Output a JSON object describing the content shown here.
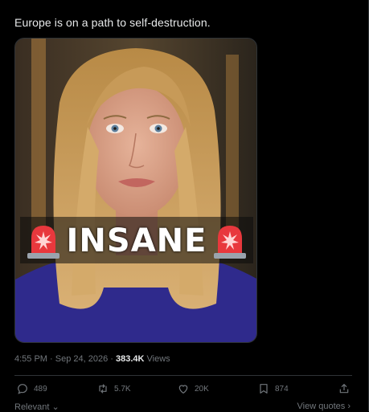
{
  "tweet": {
    "text": "Europe is on a path to self-destruction.",
    "media": {
      "overlay_text": "INSANE",
      "alarm_icon": "police-siren-emoji"
    },
    "time": "4:55 PM",
    "separator": " · ",
    "date": "Sep 24, 2026",
    "views_count": "383.4K",
    "views_label": " Views"
  },
  "actions": {
    "reply": {
      "icon": "reply-icon",
      "count": "489"
    },
    "retweet": {
      "icon": "retweet-icon",
      "count": "5.7K"
    },
    "like": {
      "icon": "heart-icon",
      "count": "20K"
    },
    "bookmark": {
      "icon": "bookmark-icon",
      "count": "874"
    },
    "share": {
      "icon": "share-icon"
    }
  },
  "footer": {
    "relevant": "Relevant",
    "view_quotes": "View quotes"
  },
  "colors": {
    "background": "#000000",
    "text": "#e7e9ea",
    "muted": "#71767b",
    "border": "#2f3336"
  }
}
